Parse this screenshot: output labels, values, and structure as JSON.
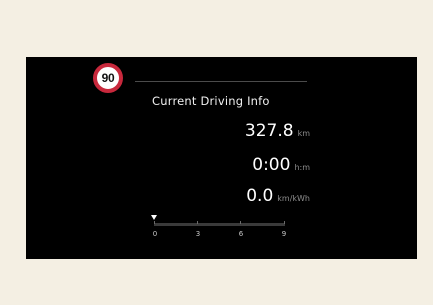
{
  "speed_limit": {
    "value": "90",
    "ring_color": "#c8283c"
  },
  "title": "Current Driving Info",
  "stats": {
    "distance": {
      "value": "327.8",
      "unit": "km"
    },
    "time": {
      "value": "0:00",
      "unit": "h:m"
    },
    "efficiency": {
      "value": "0.0",
      "unit": "km/kWh"
    }
  },
  "efficiency_scale": {
    "labels": [
      "0",
      "3",
      "6",
      "9"
    ],
    "marker_value": 0,
    "marker_icon": "triangle-down-icon"
  },
  "colors": {
    "background": "#f4efe3",
    "screen": "#000000",
    "text": "#ffffff",
    "unit_text": "#8c8c8c"
  }
}
